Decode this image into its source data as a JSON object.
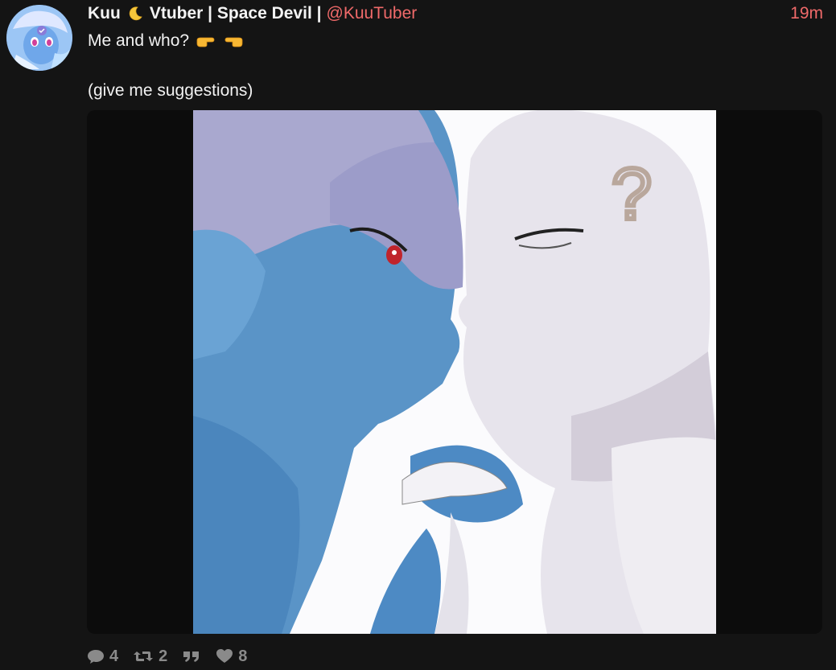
{
  "post": {
    "display_name": "Kuu",
    "display_name_suffix": "Vtuber | Space Devil |",
    "handle": "@KuuTuber",
    "timestamp": "19m",
    "text_line1": "Me and who?",
    "text_line2": "(give me suggestions)",
    "name_emoji": "crescent-moon",
    "text_emojis": [
      "backhand-index-pointing-right",
      "backhand-index-pointing-left"
    ],
    "image_description": "illustration",
    "image_question_mark": "?"
  },
  "actions": {
    "replies": "4",
    "retweets": "2",
    "likes": "8"
  },
  "icons": {
    "reply": "comment-icon",
    "retweet": "retweet-icon",
    "quote": "quote-icon",
    "like": "heart-icon"
  },
  "colors": {
    "background": "#141414",
    "handle": "#f06a6a",
    "timestamp": "#f06a6a",
    "action": "#8a8a8a",
    "media_frame": "#0c0c0c"
  }
}
